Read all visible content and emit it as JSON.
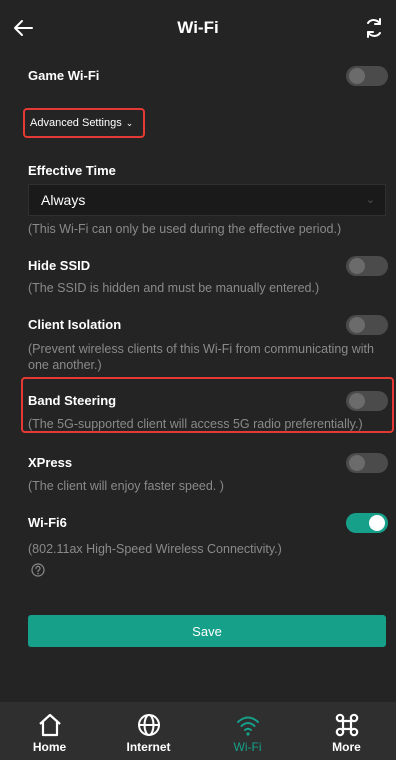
{
  "header": {
    "title": "Wi-Fi"
  },
  "game_wifi": {
    "label": "Game Wi-Fi",
    "enabled": false
  },
  "advanced": {
    "label": "Advanced Settings",
    "chevron": "chevron-down-icon"
  },
  "effective_time": {
    "label": "Effective Time",
    "value": "Always",
    "hint": "(This Wi-Fi can only be used during the effective period.)"
  },
  "hide_ssid": {
    "label": "Hide SSID",
    "desc": "(The SSID is hidden and must be manually entered.)",
    "enabled": false
  },
  "client_isolation": {
    "label": "Client Isolation",
    "desc_line1": "(Prevent wireless clients of this Wi-Fi from communicating with",
    "desc_line2": "one another.)",
    "enabled": false
  },
  "band_steering": {
    "label": "Band Steering",
    "desc": "(The 5G-supported client will access 5G radio preferentially.)",
    "enabled": false
  },
  "xpress": {
    "label": "XPress",
    "desc": "(The client will enjoy faster speed. )",
    "enabled": false
  },
  "wifi6": {
    "label": "Wi-Fi6",
    "desc": "(802.11ax High-Speed Wireless Connectivity.)",
    "enabled": true
  },
  "save_label": "Save",
  "nav": [
    {
      "label": "Home",
      "icon": "home-icon"
    },
    {
      "label": "Internet",
      "icon": "globe-icon"
    },
    {
      "label": "Wi-Fi",
      "icon": "wifi-icon",
      "active": true
    },
    {
      "label": "More",
      "icon": "more-icon"
    }
  ],
  "colors": {
    "accent": "#16a08a",
    "highlight": "#e53935",
    "background": "#242424"
  }
}
